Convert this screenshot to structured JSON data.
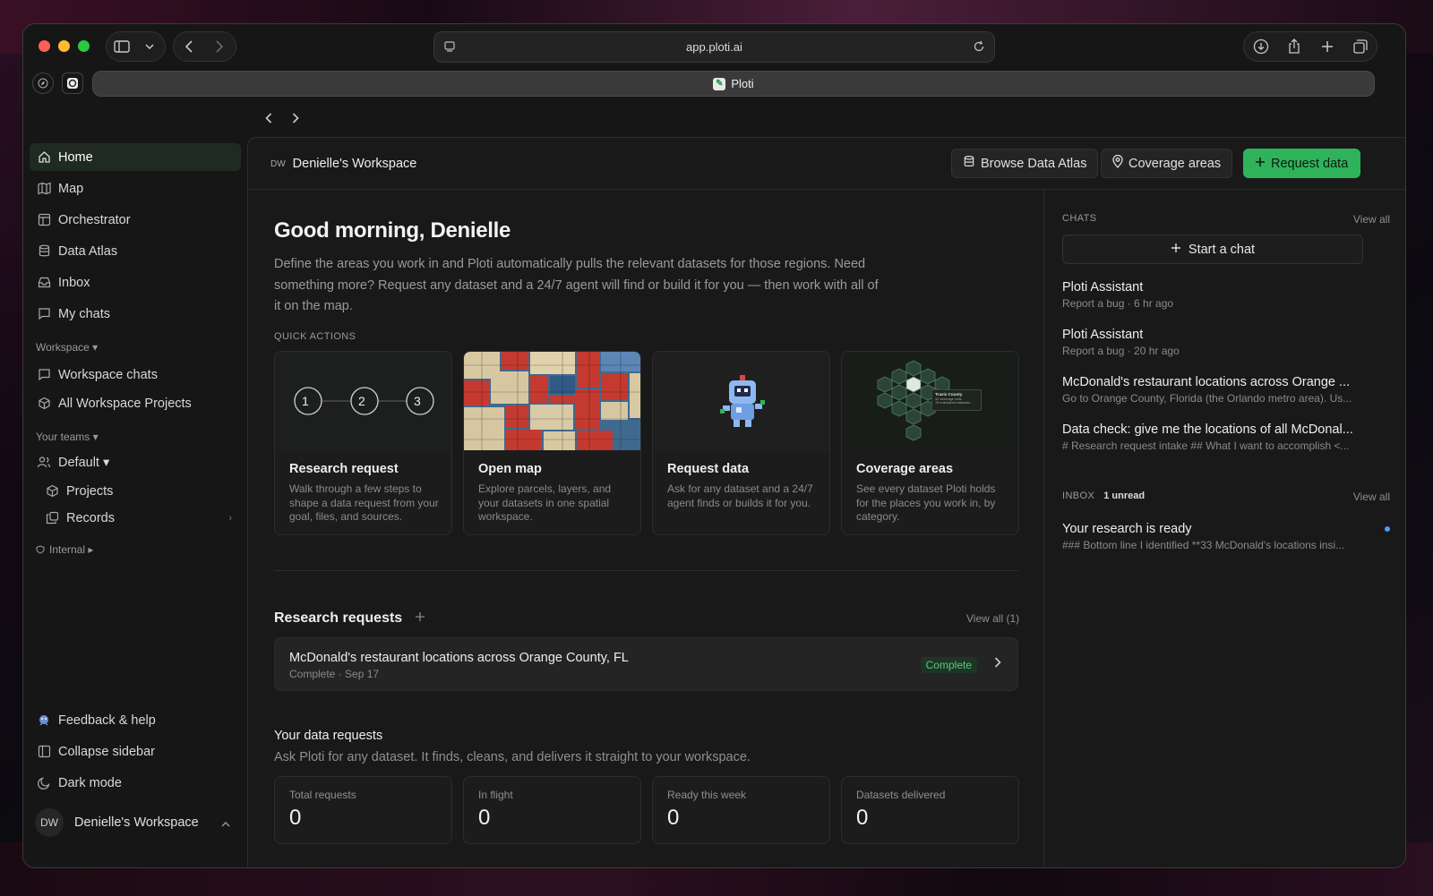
{
  "browser": {
    "url": "app.ploti.ai",
    "tab_title": "Ploti"
  },
  "sidebar": {
    "items": [
      {
        "label": "Home",
        "icon": "home-icon",
        "active": true
      },
      {
        "label": "Map",
        "icon": "map-icon"
      },
      {
        "label": "Orchestrator",
        "icon": "layout-icon"
      },
      {
        "label": "Data Atlas",
        "icon": "database-icon"
      },
      {
        "label": "Inbox",
        "icon": "inbox-icon"
      },
      {
        "label": "My chats",
        "icon": "chat-icon"
      }
    ],
    "workspace_section": "Workspace ▾",
    "workspace_items": [
      {
        "label": "Workspace chats",
        "icon": "chat-icon"
      },
      {
        "label": "All Workspace Projects",
        "icon": "cube-icon"
      }
    ],
    "teams_section": "Your teams ▾",
    "team_name": "Default ▾",
    "team_items": [
      {
        "label": "Projects",
        "icon": "cube-icon"
      },
      {
        "label": "Records",
        "icon": "records-icon"
      }
    ],
    "internal_section": "Internal ▸",
    "bottom_items": [
      {
        "label": "Feedback & help",
        "icon": "feedback-icon"
      },
      {
        "label": "Collapse sidebar",
        "icon": "collapse-icon"
      },
      {
        "label": "Dark mode",
        "icon": "moon-icon"
      }
    ],
    "workspace_initials": "DW",
    "workspace_name": "Denielle's Workspace"
  },
  "header": {
    "badge": "DW",
    "title": "Denielle's Workspace",
    "browse_label": "Browse Data Atlas",
    "coverage_label": "Coverage areas",
    "request_label": "Request data"
  },
  "main": {
    "greeting": "Good morning, Denielle",
    "intro": "Define the areas you work in and Ploti automatically pulls the relevant datasets for those regions. Need something more? Request any dataset and a 24/7 agent will find or build it for you — then work with all of it on the map.",
    "quick_actions_label": "QUICK ACTIONS",
    "quick_actions": [
      {
        "title": "Research request",
        "desc": "Walk through a few steps to shape a data request from your goal, files, and sources."
      },
      {
        "title": "Open map",
        "desc": "Explore parcels, layers, and your datasets in one spatial workspace."
      },
      {
        "title": "Request data",
        "desc": "Ask for any dataset and a 24/7 agent finds or builds it for you."
      },
      {
        "title": "Coverage areas",
        "desc": "See every dataset Ploti holds for the places you work in, by category."
      }
    ],
    "steps": [
      "1",
      "2",
      "3"
    ],
    "coverage_overlay": {
      "title": "Travis County",
      "line1": "42 coverage cells",
      "line2": "78 maintained datasets"
    },
    "research_title": "Research requests",
    "research_view_all": "View all (1)",
    "research_rows": [
      {
        "title": "McDonald's restaurant locations across Orange County, FL",
        "sub": "Complete · Sep 17",
        "status": "Complete"
      }
    ],
    "data_requests_title": "Your data requests",
    "data_requests_sub": "Ask Ploti for any dataset. It finds, cleans, and delivers it straight to your workspace.",
    "stats": [
      {
        "label": "Total requests",
        "value": "0"
      },
      {
        "label": "In flight",
        "value": "0"
      },
      {
        "label": "Ready this week",
        "value": "0"
      },
      {
        "label": "Datasets delivered",
        "value": "0"
      }
    ]
  },
  "right": {
    "chats_label": "CHATS",
    "chats_view_all": "View all",
    "start_chat": "Start a chat",
    "chats": [
      {
        "title": "Ploti Assistant",
        "sub": "Report a bug · 6 hr ago"
      },
      {
        "title": "Ploti Assistant",
        "sub": "Report a bug · 20 hr ago"
      },
      {
        "title": "McDonald's restaurant locations across Orange ...",
        "sub": "Go to Orange County, Florida (the Orlando metro area). Us..."
      },
      {
        "title": "Data check: give me the locations of all McDonal...",
        "sub": "# Research request intake ## What I want to accomplish <..."
      }
    ],
    "inbox_label": "INBOX",
    "inbox_unread": "1 unread",
    "inbox_view_all": "View all",
    "inbox_items": [
      {
        "title": "Your research is ready",
        "sub": "### Bottom line I identified **33 McDonald's locations insi..."
      }
    ]
  },
  "colors": {
    "accent": "#2fb35a",
    "active_bg": "#1f2a22",
    "status_complete": "#4fce7c",
    "unread_dot": "#4a9cff"
  }
}
